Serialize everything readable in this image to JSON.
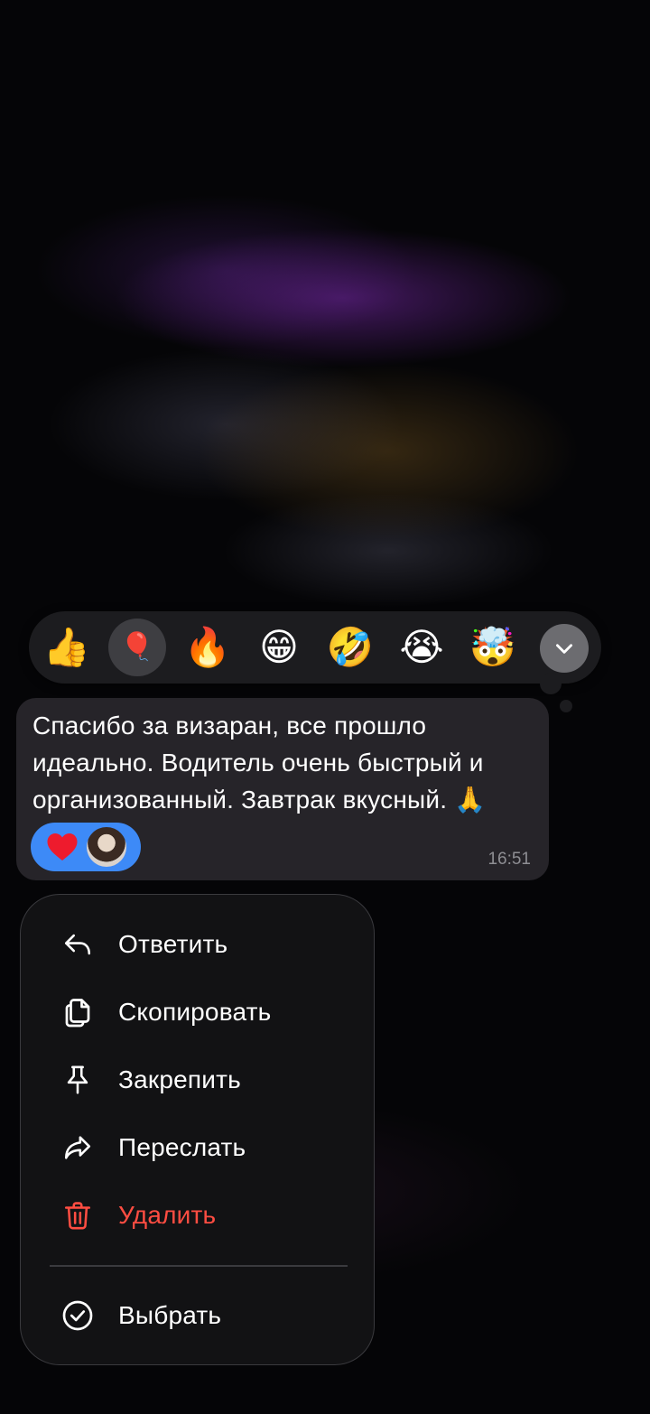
{
  "reactions": [
    {
      "emoji": "👍",
      "name": "thumbs-up"
    },
    {
      "emoji": "🎈",
      "name": "balloon",
      "selected": true
    },
    {
      "emoji": "🔥",
      "name": "fire"
    },
    {
      "emoji": "😁",
      "name": "grin"
    },
    {
      "emoji": "🤣",
      "name": "rofl"
    },
    {
      "emoji": "😭",
      "name": "crying"
    },
    {
      "emoji": "🤯",
      "name": "exploding-head"
    }
  ],
  "message": {
    "text": "Спасибо за визаран, все прошло идеально. Водитель очень быстрый и организованный. Завтрак вкусный. 🙏",
    "time": "16:51",
    "reaction": "❤"
  },
  "menu": {
    "reply": "Ответить",
    "copy": "Скопировать",
    "pin": "Закрепить",
    "forward": "Переслать",
    "delete": "Удалить",
    "select": "Выбрать"
  },
  "colors": {
    "accent": "#3d8af7",
    "danger": "#ff4d42",
    "bubble": "#262429",
    "menu_bg": "#121214"
  }
}
